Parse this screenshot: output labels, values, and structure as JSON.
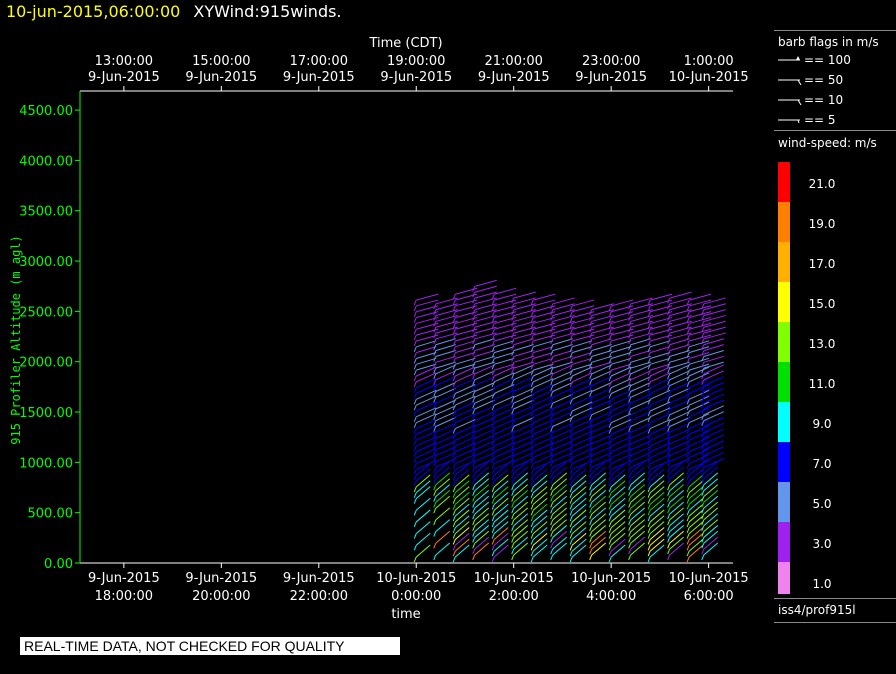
{
  "header": {
    "datetime": "10-jun-2015,06:00:00",
    "product": "XYWind:915winds."
  },
  "chart_data": {
    "type": "scatter",
    "title": "",
    "top_axis_title": "Time (CDT)",
    "xlabel": "time",
    "ylabel": "915 Profiler Altitude (m agl)",
    "ylim": [
      0,
      4600
    ],
    "y_ticks": [
      0,
      500,
      1000,
      1500,
      2000,
      2500,
      3000,
      3500,
      4000,
      4500
    ],
    "y_tick_labels": [
      "0.00",
      "500.00",
      "1000.00",
      "1500.00",
      "2000.00",
      "2500.00",
      "3000.00",
      "3500.00",
      "4000.00",
      "4500.00"
    ],
    "x_range_utc_hours": [
      17,
      30.5
    ],
    "bottom_ticks": [
      {
        "hour_utc": 18,
        "line1": "9-Jun-2015",
        "line2": "18:00:00"
      },
      {
        "hour_utc": 20,
        "line1": "9-Jun-2015",
        "line2": "20:00:00"
      },
      {
        "hour_utc": 22,
        "line1": "9-Jun-2015",
        "line2": "22:00:00"
      },
      {
        "hour_utc": 24,
        "line1": "10-Jun-2015",
        "line2": "0:00:00"
      },
      {
        "hour_utc": 26,
        "line1": "10-Jun-2015",
        "line2": "2:00:00"
      },
      {
        "hour_utc": 28,
        "line1": "10-Jun-2015",
        "line2": "4:00:00"
      },
      {
        "hour_utc": 30,
        "line1": "10-Jun-2015",
        "line2": "6:00:00"
      }
    ],
    "top_ticks": [
      {
        "hour_utc": 18,
        "line1": "13:00:00",
        "line2": "9-Jun-2015"
      },
      {
        "hour_utc": 20,
        "line1": "15:00:00",
        "line2": "9-Jun-2015"
      },
      {
        "hour_utc": 22,
        "line1": "17:00:00",
        "line2": "9-Jun-2015"
      },
      {
        "hour_utc": 24,
        "line1": "19:00:00",
        "line2": "9-Jun-2015"
      },
      {
        "hour_utc": 26,
        "line1": "21:00:00",
        "line2": "9-Jun-2015"
      },
      {
        "hour_utc": 28,
        "line1": "23:00:00",
        "line2": "9-Jun-2015"
      },
      {
        "hour_utc": 30,
        "line1": "1:00:00",
        "line2": "10-Jun-2015"
      }
    ],
    "profile_times_utc_hours": [
      24.0,
      24.4,
      24.8,
      25.2,
      25.6,
      26.0,
      26.4,
      26.8,
      27.2,
      27.6,
      28.0,
      28.4,
      28.8,
      29.2,
      29.6,
      29.9
    ],
    "profile_tops_m": [
      2650,
      2600,
      2700,
      2750,
      2720,
      2680,
      2640,
      2620,
      2580,
      2560,
      2600,
      2620,
      2640,
      2650,
      2640,
      2600
    ],
    "gate_spacing_m": 58
  },
  "legend": {
    "barb_title": "barb flags in m/s",
    "barbs": [
      "== 100",
      "== 50",
      "== 10",
      "== 5"
    ],
    "speed_title": "wind-speed: m/s",
    "speed_labels": [
      "21.0",
      "19.0",
      "17.0",
      "15.0",
      "13.0",
      "11.0",
      "9.0",
      "7.0",
      "5.0",
      "3.0",
      "1.0"
    ],
    "speed_colors": [
      "#ff0000",
      "#ff8000",
      "#ffb000",
      "#ffff00",
      "#80ff00",
      "#00e000",
      "#00ffff",
      "#0000ff",
      "#6495ed",
      "#a020f0",
      "#ee82ee"
    ],
    "source": "iss4/prof915l"
  },
  "colors": {
    "axis": "#ffffff",
    "y_axis": "#00ff00",
    "title_date": "#ffff00"
  },
  "footer": {
    "warning": "REAL-TIME DATA, NOT CHECKED FOR QUALITY"
  }
}
